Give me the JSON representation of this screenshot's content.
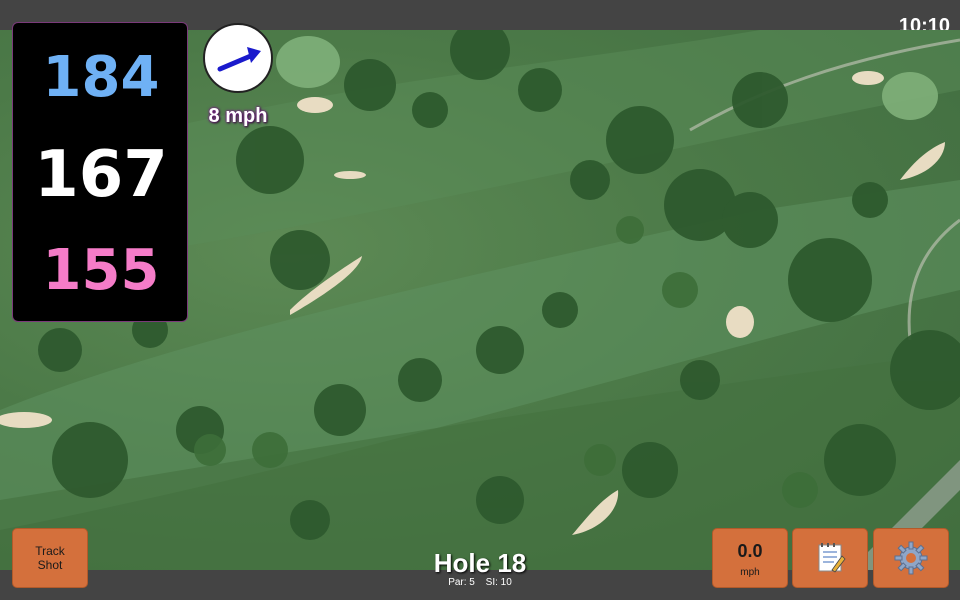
{
  "status": {
    "clock": "10:10"
  },
  "distances": {
    "back": "184",
    "middle": "167",
    "front": "155"
  },
  "wind": {
    "speed": "8 mph",
    "direction_icon": "wind-arrow-icon"
  },
  "hole": {
    "title": "Hole 18",
    "par_label": "Par: 5",
    "si_label": "SI: 10"
  },
  "buttons": {
    "track_shot": "Track\nShot",
    "speed_value": "0.0",
    "speed_unit": "mph",
    "notes_icon": "notepad-icon",
    "settings_icon": "gear-icon"
  },
  "colors": {
    "back_distance": "#6fb1f5",
    "middle_distance": "#ffffff",
    "front_distance": "#f57cc8",
    "button_bg": "#d4703c"
  }
}
